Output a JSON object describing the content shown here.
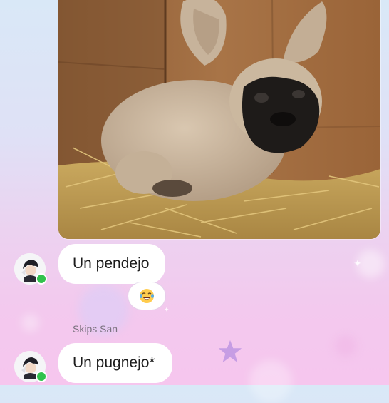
{
  "messages": [
    {
      "type": "image",
      "image_icon": "photo-pug-bunny-icon"
    },
    {
      "type": "text",
      "text": "Un pendejo",
      "reaction_icon": "laughing-tears-emoji-icon"
    },
    {
      "type": "text",
      "sender": "Skips San",
      "text": "Un pugnejo*"
    }
  ],
  "status": {
    "online_color": "#31c24d"
  },
  "theme": {
    "bubble_color": "#ffffff",
    "background_colors": [
      "#d9e8f7",
      "#f6c6ee"
    ]
  }
}
